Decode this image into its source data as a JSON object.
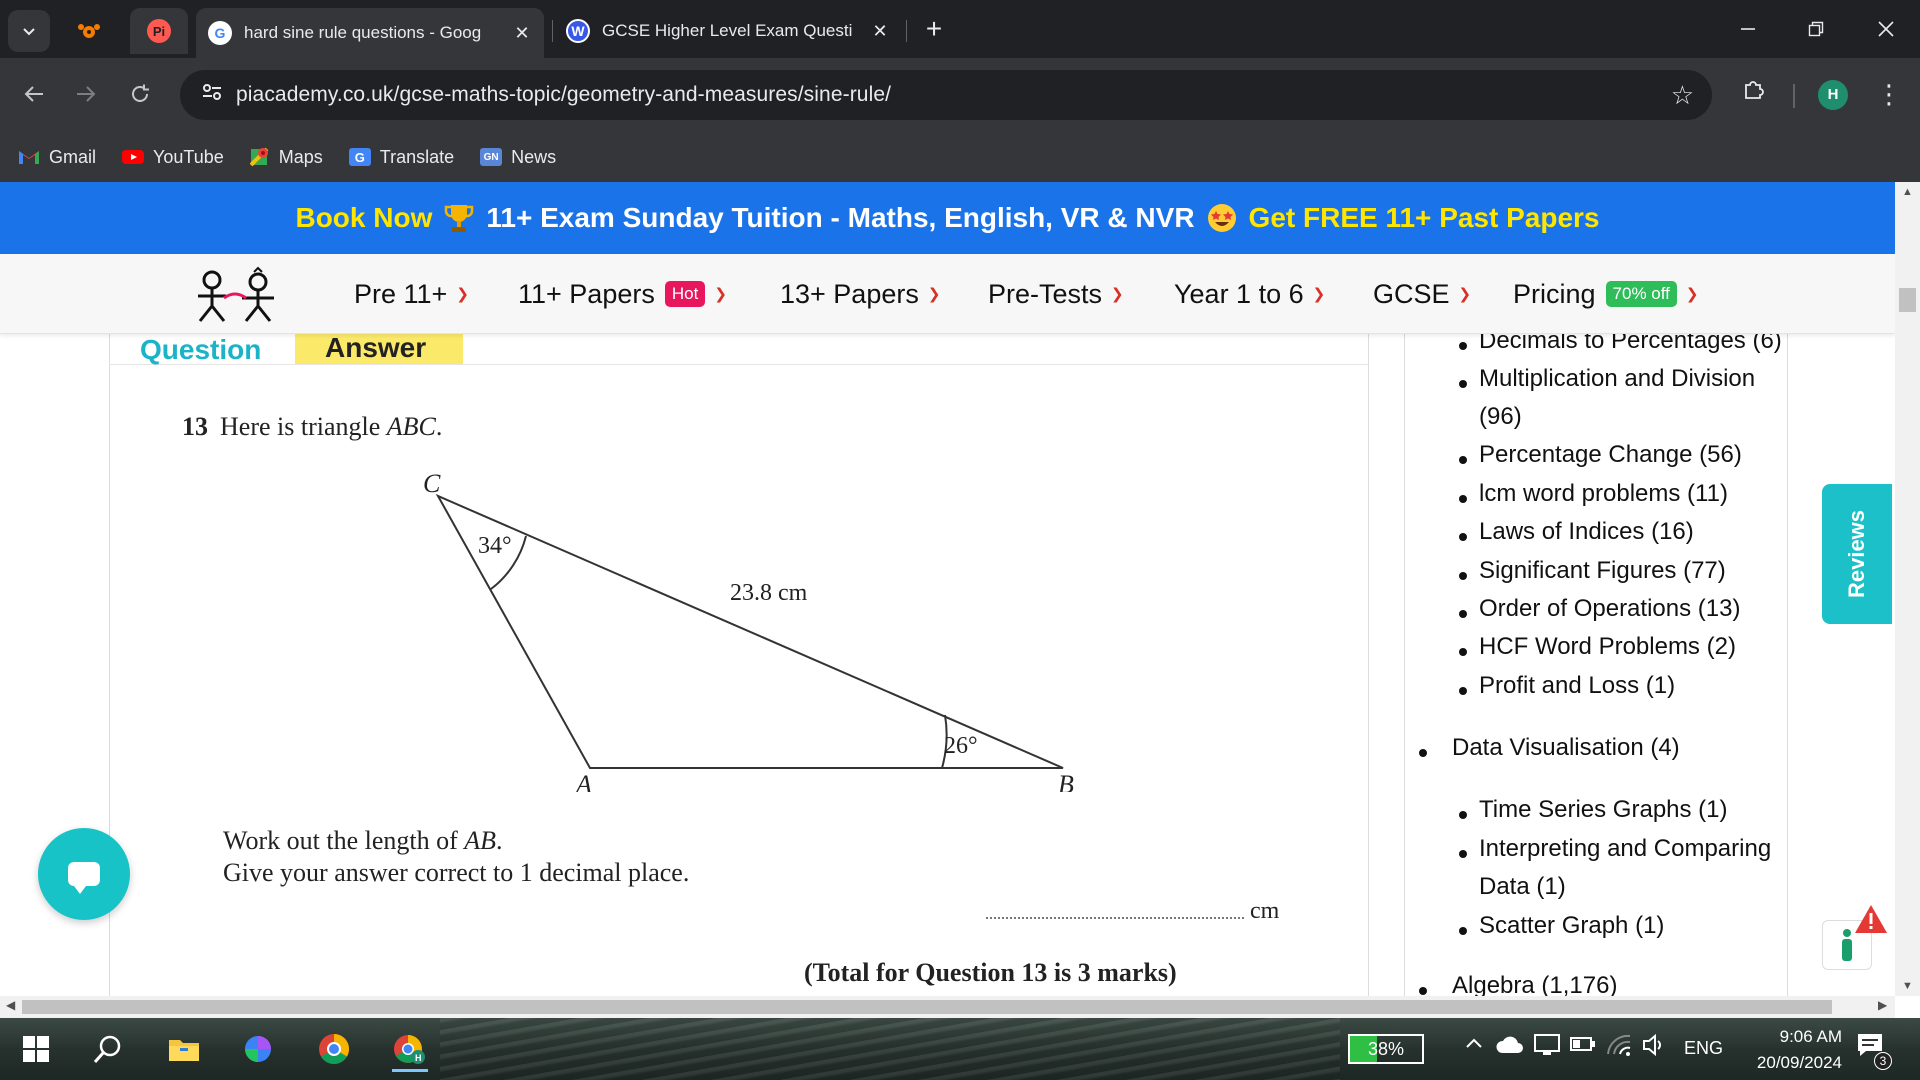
{
  "browser": {
    "tabs": [
      {
        "title": "hard sine rule questions - Goog",
        "favicon": "google-g-icon",
        "active": true
      },
      {
        "title": "GCSE Higher Level Exam Questi",
        "favicon": "wordpress-icon",
        "active": false
      }
    ],
    "pinned_tabs": [
      "pi-academy-icon",
      "pi-academy-red-icon"
    ],
    "url": "piacademy.co.uk/gcse-maths-topic/geometry-and-measures/sine-rule/",
    "profile_initial": "H",
    "bookmarks": [
      {
        "label": "Gmail",
        "icon": "gmail-icon"
      },
      {
        "label": "YouTube",
        "icon": "youtube-icon"
      },
      {
        "label": "Maps",
        "icon": "maps-icon"
      },
      {
        "label": "Translate",
        "icon": "translate-icon"
      },
      {
        "label": "News",
        "icon": "news-icon"
      }
    ]
  },
  "promo": {
    "book_now": "Book Now",
    "middle": "11+ Exam Sunday Tuition - Maths, English, VR & NVR",
    "cta": "Get FREE 11+ Past Papers"
  },
  "nav": {
    "items": [
      {
        "label": "Pre 11+"
      },
      {
        "label": "11+ Papers",
        "badge": "Hot"
      },
      {
        "label": "13+ Papers"
      },
      {
        "label": "Pre-Tests"
      },
      {
        "label": "Year 1 to 6"
      },
      {
        "label": "GCSE"
      },
      {
        "label": "Pricing",
        "badge": "70% off"
      }
    ]
  },
  "tabs": {
    "question": "Question",
    "answer": "Answer"
  },
  "question": {
    "number": "13",
    "intro": "Here is triangle",
    "intro_var": "ABC",
    "intro_end": ".",
    "diagram": {
      "vertex_c": "C",
      "vertex_a": "A",
      "vertex_b": "B",
      "angle_c": "34°",
      "angle_b": "26°",
      "side_cb": "23.8 cm"
    },
    "instruction_1_pre": "Work out the length of",
    "instruction_1_var": "AB",
    "instruction_1_end": ".",
    "instruction_2": "Give your answer correct to 1 decimal place.",
    "answer_unit": "cm",
    "total": "(Total for Question 13 is 3 marks)"
  },
  "sidebar": {
    "top_items": [
      "Decimals to Percentages (6)",
      "Multiplication and Division",
      "(96)",
      "Percentage Change (56)",
      "lcm word problems (11)",
      "Laws of Indices (16)",
      "Significant Figures (77)",
      "Order of Operations (13)",
      "HCF Word Problems (2)",
      "Profit and Loss (1)"
    ],
    "section_data_vis": "Data Visualisation (4)",
    "data_vis_items": [
      "Time Series Graphs (1)",
      "Interpreting and Comparing",
      "Data (1)",
      "Scatter Graph (1)"
    ],
    "section_algebra": "Algebra (1,176)"
  },
  "widgets": {
    "reviews": "Reviews"
  },
  "taskbar": {
    "battery_percent": 38,
    "battery_label": "38%",
    "language": "ENG",
    "time": "9:06 AM",
    "date": "20/09/2024",
    "notifications": "3"
  },
  "colors": {
    "promo_bg": "#1a73e8",
    "promo_yellow": "#ffe600",
    "accent_teal": "#1bc0c9",
    "answer_tab": "#fbe96a",
    "hot_badge": "#e8175d",
    "discount_badge": "#2ebd59",
    "caret": "#d93025"
  }
}
